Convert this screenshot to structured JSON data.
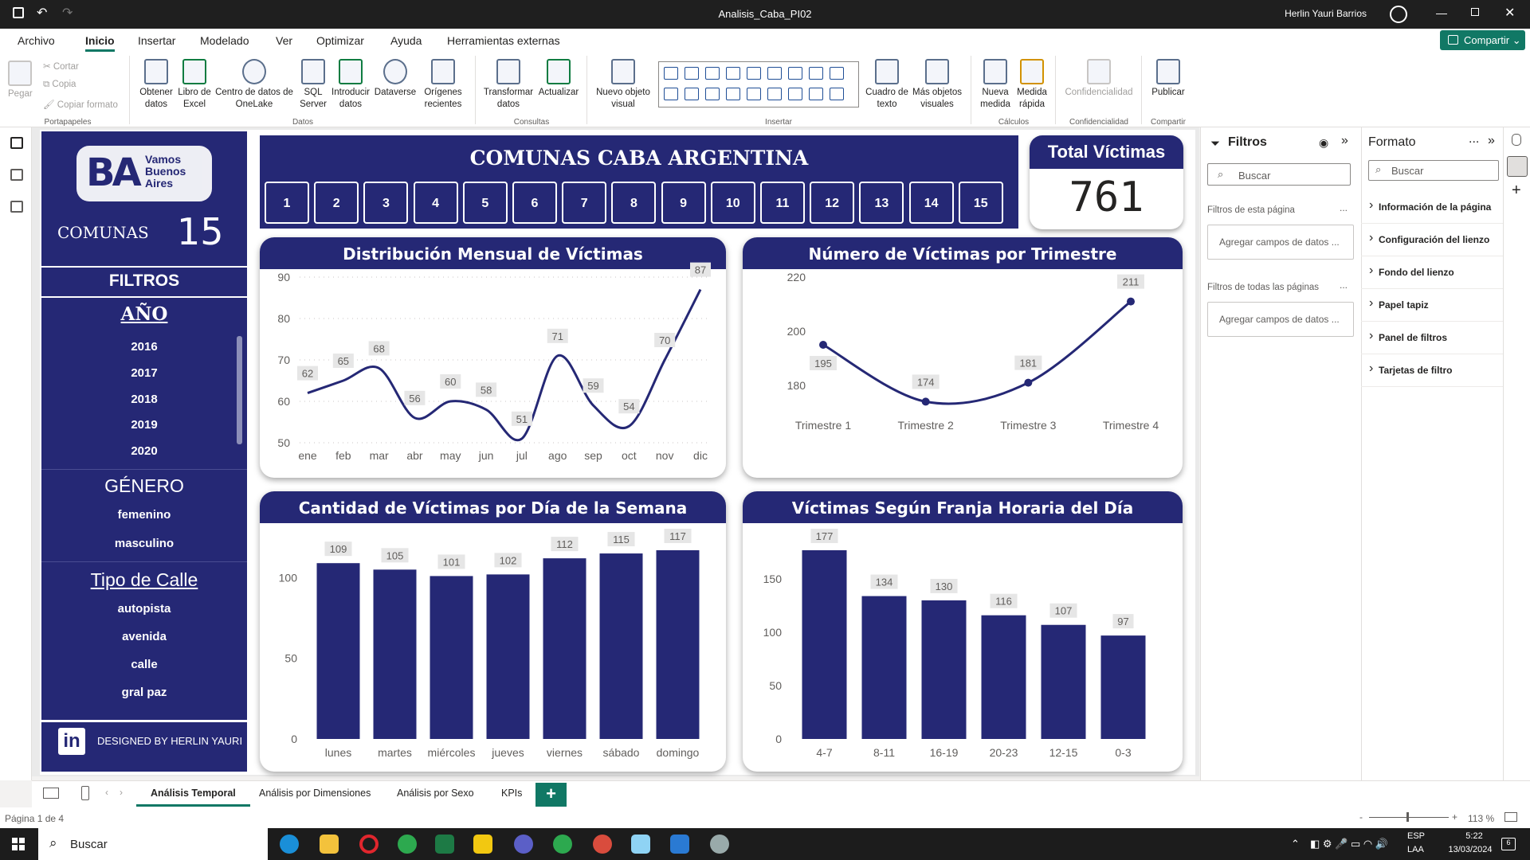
{
  "window": {
    "title": "Analisis_Caba_PI02",
    "user": "Herlin Yauri Barrios"
  },
  "menu": {
    "tabs": [
      "Archivo",
      "Inicio",
      "Insertar",
      "Modelado",
      "Ver",
      "Optimizar",
      "Ayuda",
      "Herramientas externas"
    ],
    "active": "Inicio",
    "share_label": "Compartir"
  },
  "ribbon": {
    "clipboard": {
      "paste": "Pegar",
      "cut": "Cortar",
      "copy": "Copia",
      "format_painter": "Copiar formato",
      "group": "Portapapeles"
    },
    "data": {
      "get_data": "Obtener datos",
      "excel": "Libro de Excel",
      "onelake": "Centro de datos de OneLake",
      "sql": "SQL Server",
      "enter_data": "Introducir datos",
      "dataverse": "Dataverse",
      "recent": "Orígenes recientes",
      "group": "Datos"
    },
    "queries": {
      "transform": "Transformar datos",
      "refresh": "Actualizar",
      "group": "Consultas"
    },
    "insert": {
      "new_visual": "Nuevo objeto visual",
      "text_box": "Cuadro de texto",
      "more_visuals": "Más objetos visuales",
      "group": "Insertar"
    },
    "calculations": {
      "new_measure": "Nueva medida",
      "quick_measure": "Medida rápida",
      "group": "Cálculos"
    },
    "sensitivity": {
      "label": "Confidencialidad",
      "group": "Confidencialidad"
    },
    "share": {
      "publish": "Publicar",
      "group": "Compartir"
    }
  },
  "sidebar": {
    "logo_text": "BA",
    "logo_tagline": "Vamos Buenos Aires",
    "comunas_label": "COMUNAS",
    "comunas_count": "15",
    "filters_title": "FILTROS",
    "year_title": "AÑO",
    "years": [
      "2016",
      "2017",
      "2018",
      "2019",
      "2020"
    ],
    "gender_title": "GÉNERO",
    "genders": [
      "femenino",
      "masculino"
    ],
    "street_title": "Tipo de Calle",
    "streets": [
      "autopista",
      "avenida",
      "calle",
      "gral paz"
    ],
    "credit": "DESIGNED BY HERLIN YAURI",
    "linkedin_icon": "in"
  },
  "header": {
    "title": "COMUNAS CABA ARGENTINA",
    "comunas": [
      "1",
      "2",
      "3",
      "4",
      "5",
      "6",
      "7",
      "8",
      "9",
      "10",
      "11",
      "12",
      "13",
      "14",
      "15"
    ]
  },
  "kpi": {
    "label": "Total Víctimas",
    "value": "761"
  },
  "chart_data": [
    {
      "type": "line",
      "title": "Distribución Mensual de Víctimas",
      "categories": [
        "ene",
        "feb",
        "mar",
        "abr",
        "may",
        "jun",
        "jul",
        "ago",
        "sep",
        "oct",
        "nov",
        "dic"
      ],
      "values": [
        62,
        65,
        68,
        56,
        60,
        58,
        51,
        71,
        59,
        54,
        70,
        87
      ],
      "yticks": [
        50,
        60,
        70,
        80,
        90
      ],
      "ylim": [
        50,
        90
      ]
    },
    {
      "type": "line",
      "title": "Número de Víctimas por Trimestre",
      "categories": [
        "Trimestre 1",
        "Trimestre 2",
        "Trimestre 3",
        "Trimestre 4"
      ],
      "values": [
        195,
        174,
        181,
        211
      ],
      "yticks": [
        180,
        200,
        220
      ],
      "ylim": [
        170,
        220
      ]
    },
    {
      "type": "bar",
      "title": "Cantidad de Víctimas por Día de la Semana",
      "categories": [
        "lunes",
        "martes",
        "miércoles",
        "jueves",
        "viernes",
        "sábado",
        "domingo"
      ],
      "values": [
        109,
        105,
        101,
        102,
        112,
        115,
        117
      ],
      "yticks": [
        0,
        50,
        100
      ],
      "ylim": [
        0,
        117
      ]
    },
    {
      "type": "bar",
      "title": "Víctimas Según Franja Horaria del Día",
      "categories": [
        "4-7",
        "8-11",
        "16-19",
        "20-23",
        "12-15",
        "0-3"
      ],
      "values": [
        177,
        134,
        130,
        116,
        107,
        97
      ],
      "yticks": [
        0,
        50,
        100,
        150
      ],
      "ylim": [
        0,
        177
      ]
    }
  ],
  "filters_pane": {
    "title": "Filtros",
    "search_placeholder": "Buscar",
    "page_filters": "Filtros de esta página",
    "all_filters": "Filtros de todas las páginas",
    "add_fields": "Agregar campos de datos ...",
    "more": "..."
  },
  "format_pane": {
    "title": "Formato",
    "search_placeholder": "Buscar",
    "more": "...",
    "sections": [
      "Información de la página",
      "Configuración del lienzo",
      "Fondo del lienzo",
      "Papel tapiz",
      "Panel de filtros",
      "Tarjetas de filtro"
    ]
  },
  "pages": {
    "tabs": [
      "Análisis Temporal",
      "Análisis por Dimensiones",
      "Análisis por Sexo",
      "KPIs"
    ],
    "active": "Análisis Temporal",
    "add": "+"
  },
  "status": {
    "page": "Página 1 de 4",
    "zoom": "113 %",
    "zoom_minus": "-",
    "zoom_plus": "+"
  },
  "taskbar": {
    "search": "Buscar",
    "lang": "ESP",
    "layout": "LAA",
    "time": "5:22",
    "date": "13/03/2024",
    "notifications": "6"
  },
  "colors": {
    "navy": "#252875",
    "accent": "#117865"
  }
}
